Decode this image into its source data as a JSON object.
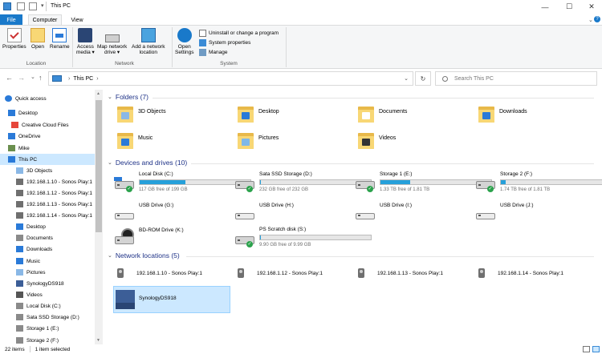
{
  "window": {
    "title": "This PC",
    "controls": {
      "minimize": "—",
      "maximize": "☐",
      "close": "✕"
    }
  },
  "ribbon": {
    "tabs": [
      {
        "label": "File"
      },
      {
        "label": "Computer"
      },
      {
        "label": "View"
      }
    ],
    "groups": {
      "location": {
        "label": "Location",
        "buttons": [
          {
            "label": "Properties",
            "icon": "properties-icon"
          },
          {
            "label": "Open",
            "icon": "open-folder-icon"
          },
          {
            "label": "Rename",
            "icon": "rename-icon"
          }
        ]
      },
      "network": {
        "label": "Network",
        "buttons": [
          {
            "line1": "Access",
            "line2": "media ▾",
            "icon": "media-icon"
          },
          {
            "line1": "Map network",
            "line2": "drive ▾",
            "icon": "network-drive-icon"
          },
          {
            "line1": "Add a network",
            "line2": "location",
            "icon": "network-location-icon"
          }
        ]
      },
      "system": {
        "label": "System",
        "open_settings_line1": "Open",
        "open_settings_line2": "Settings",
        "items": [
          {
            "label": "Uninstall or change a program"
          },
          {
            "label": "System properties"
          },
          {
            "label": "Manage"
          }
        ]
      }
    }
  },
  "address": {
    "location": "This PC",
    "separator": "›",
    "search_placeholder": "Search This PC",
    "back": "←",
    "forward": "→",
    "recent": "⌄",
    "up": "↑",
    "dropdown": "⌄",
    "refresh": "↻"
  },
  "nav_pane": {
    "items": [
      {
        "label": "Quick access",
        "icon": "star-icon",
        "color": "#2a7ad8"
      },
      {
        "label": "Desktop",
        "icon": "desktop-icon",
        "color": "#2a7ad8"
      },
      {
        "label": "Creative Cloud Files",
        "icon": "creative-cloud-icon",
        "color": "#e6463b"
      },
      {
        "label": "OneDrive",
        "icon": "onedrive-icon",
        "color": "#2a7ad8"
      },
      {
        "label": "Mike",
        "icon": "user-icon",
        "color": "#6a8f4e"
      },
      {
        "label": "This PC",
        "icon": "pc-icon",
        "color": "#2a7ad8",
        "selected": true
      },
      {
        "label": "3D Objects",
        "icon": "folder-icon",
        "color": "#8ab8e6"
      },
      {
        "label": "192.168.1.10 - Sonos Play:1",
        "icon": "network-device-icon",
        "color": "#6f6f6f"
      },
      {
        "label": "192.168.1.12 - Sonos Play:1",
        "icon": "network-device-icon",
        "color": "#6f6f6f"
      },
      {
        "label": "192.168.1.13 - Sonos Play:1",
        "icon": "network-device-icon",
        "color": "#6f6f6f"
      },
      {
        "label": "192.168.1.14 - Sonos Play:1",
        "icon": "network-device-icon",
        "color": "#6f6f6f"
      },
      {
        "label": "Desktop",
        "icon": "desktop-icon",
        "color": "#2a7ad8"
      },
      {
        "label": "Documents",
        "icon": "documents-icon",
        "color": "#8a8a8a"
      },
      {
        "label": "Downloads",
        "icon": "downloads-icon",
        "color": "#2a7ad8"
      },
      {
        "label": "Music",
        "icon": "music-icon",
        "color": "#2a7ad8"
      },
      {
        "label": "Pictures",
        "icon": "pictures-icon",
        "color": "#8ab8e6"
      },
      {
        "label": "SynologyDS918",
        "icon": "nas-icon",
        "color": "#3c5e97"
      },
      {
        "label": "Videos",
        "icon": "videos-icon",
        "color": "#555555"
      },
      {
        "label": "Local Disk (C:)",
        "icon": "drive-icon",
        "color": "#8a8a8a"
      },
      {
        "label": "Sata SSD Storage (D:)",
        "icon": "drive-icon",
        "color": "#8a8a8a"
      },
      {
        "label": "Storage 1 (E:)",
        "icon": "drive-icon",
        "color": "#8a8a8a"
      },
      {
        "label": "Storage 2 (F:)",
        "icon": "drive-icon",
        "color": "#8a8a8a"
      }
    ]
  },
  "folders": {
    "header": "Folders (7)",
    "items": [
      {
        "label": "3D Objects",
        "badge": "#8ab8e6"
      },
      {
        "label": "Desktop",
        "badge": "#2a7ad8"
      },
      {
        "label": "Documents",
        "badge": "#ffffff"
      },
      {
        "label": "Downloads",
        "badge": "#2a7ad8"
      },
      {
        "label": "Music",
        "badge": "#2a7ad8"
      },
      {
        "label": "Pictures",
        "badge": "#7fb8e8"
      },
      {
        "label": "Videos",
        "badge": "#333333"
      }
    ]
  },
  "drives": {
    "header": "Devices and drives (10)",
    "items": [
      {
        "label": "Local Disk (C:)",
        "free": "117 GB free of 199 GB",
        "used_fraction": 0.41,
        "type": "hdd",
        "windows": true,
        "check": true
      },
      {
        "label": "Sata SSD Storage (D:)",
        "free": "232 GB free of 232 GB",
        "used_fraction": 0.01,
        "type": "hdd",
        "check": true
      },
      {
        "label": "Storage 1 (E:)",
        "free": "1.33 TB free of 1.81 TB",
        "used_fraction": 0.27,
        "type": "hdd",
        "check": true
      },
      {
        "label": "Storage 2 (F:)",
        "free": "1.74 TB free of 1.81 TB",
        "used_fraction": 0.04,
        "type": "hdd",
        "check": true
      },
      {
        "label": "USB Drive (G:)",
        "type": "usb"
      },
      {
        "label": "USB Drive (H:)",
        "type": "usb"
      },
      {
        "label": "USB Drive (I:)",
        "type": "usb"
      },
      {
        "label": "USB Drive (J:)",
        "type": "usb"
      },
      {
        "label": "BD-ROM Drive (K:)",
        "type": "bd"
      },
      {
        "label": "PS Scratch disk (S:)",
        "free": "9.90 GB free of 9.99 GB",
        "used_fraction": 0.01,
        "type": "hdd",
        "check": true
      }
    ]
  },
  "network": {
    "header": "Network locations (5)",
    "items": [
      {
        "label": "192.168.1.10 - Sonos Play:1"
      },
      {
        "label": "192.168.1.12 - Sonos Play:1"
      },
      {
        "label": "192.168.1.13 - Sonos Play:1"
      },
      {
        "label": "192.168.1.14 - Sonos Play:1"
      },
      {
        "label": "SynologyDS918",
        "selected": true
      }
    ]
  },
  "status": {
    "count": "22 items",
    "selected": "1 item selected"
  }
}
